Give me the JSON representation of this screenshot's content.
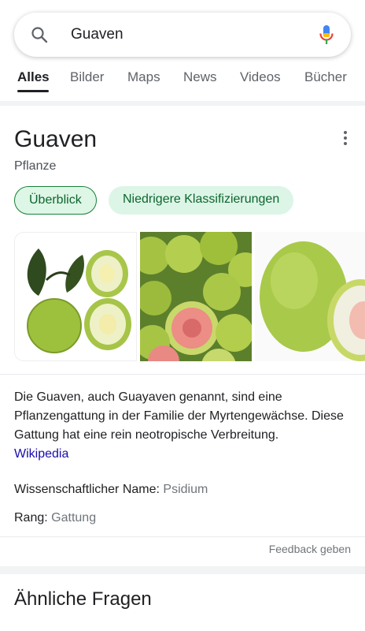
{
  "search": {
    "query": "Guaven",
    "search_icon": "search-icon",
    "mic_icon": "microphone-icon"
  },
  "tabs": [
    {
      "label": "Alles",
      "active": true
    },
    {
      "label": "Bilder"
    },
    {
      "label": "Maps"
    },
    {
      "label": "News"
    },
    {
      "label": "Videos"
    },
    {
      "label": "Bücher"
    }
  ],
  "knowledge_panel": {
    "title": "Guaven",
    "subtitle": "Pflanze",
    "menu_icon": "more-vert-icon",
    "chips": [
      {
        "label": "Überblick",
        "selected": true
      },
      {
        "label": "Niedrigere Klassifizierungen"
      }
    ],
    "description": "Die Guaven, auch Guayaven genannt, sind eine Pflanzengattung in der Familie der Myrtengewächse. Diese Gattung hat eine rein neotropische Verbreitung.",
    "source_link": "Wikipedia",
    "facts": [
      {
        "label": "Wissenschaftlicher Name:",
        "value": "Psidium"
      },
      {
        "label": "Rang:",
        "value": "Gattung"
      }
    ],
    "feedback": "Feedback geben"
  },
  "related": {
    "title": "Ähnliche Fragen"
  },
  "colors": {
    "chip_bg": "#dcf5e7",
    "chip_text": "#0d652d",
    "chip_border": "#188038",
    "link": "#1a0dab"
  }
}
